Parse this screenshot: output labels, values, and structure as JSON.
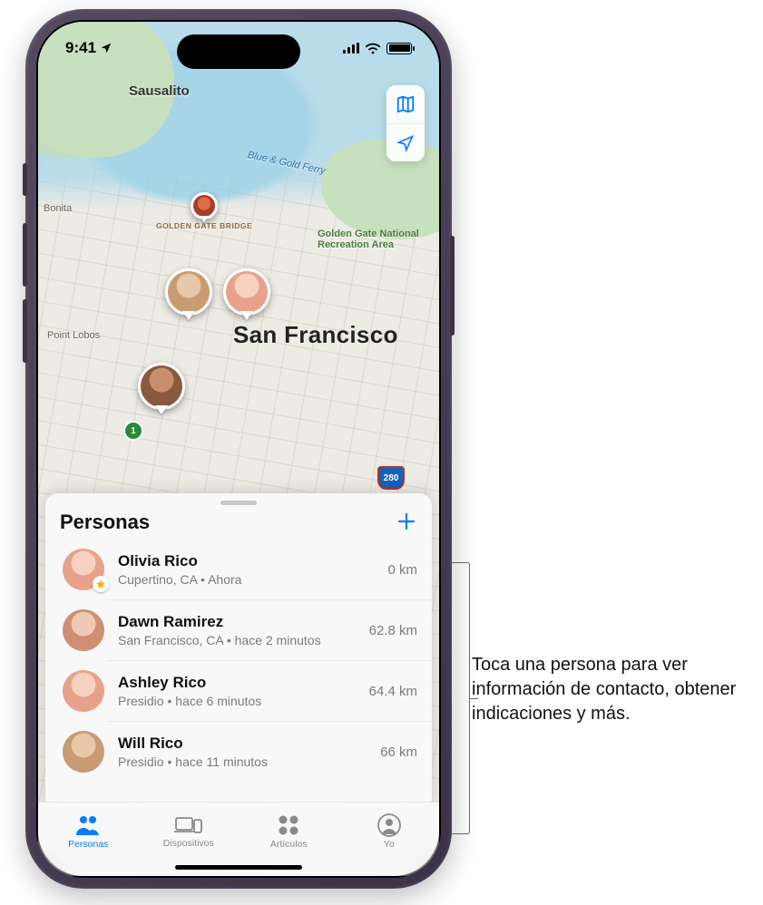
{
  "status": {
    "time": "9:41",
    "location_icon": "location-arrow"
  },
  "map": {
    "labels": {
      "sausalito": "Sausalito",
      "bonita": "Bonita",
      "point_lobos": "Point Lobos",
      "city": "San Francisco",
      "ferry": "Blue & Gold Ferry",
      "bridge": "GOLDEN GATE BRIDGE",
      "park": "Golden Gate National Recreation Area",
      "hw1": "1",
      "hw280": "280"
    }
  },
  "sheet": {
    "title": "Personas"
  },
  "people": [
    {
      "name": "Olivia Rico",
      "location": "Cupertino, CA",
      "time": "Ahora",
      "distance": "0 km",
      "favorite": true,
      "avatar": "av-a"
    },
    {
      "name": "Dawn Ramirez",
      "location": "San Francisco, CA",
      "time": "hace 2 minutos",
      "distance": "62.8 km",
      "favorite": false,
      "avatar": "av-b"
    },
    {
      "name": "Ashley Rico",
      "location": "Presidio",
      "time": "hace 6 minutos",
      "distance": "64.4 km",
      "favorite": false,
      "avatar": "av-a"
    },
    {
      "name": "Will Rico",
      "location": "Presidio",
      "time": "hace 11 minutos",
      "distance": "66 km",
      "favorite": false,
      "avatar": "av-d"
    }
  ],
  "tabs": {
    "people": "Personas",
    "devices": "Dispositivos",
    "items": "Artículos",
    "me": "Yo"
  },
  "callout": {
    "text": "Toca una persona para ver información de contacto, obtener indicaciones y más."
  }
}
